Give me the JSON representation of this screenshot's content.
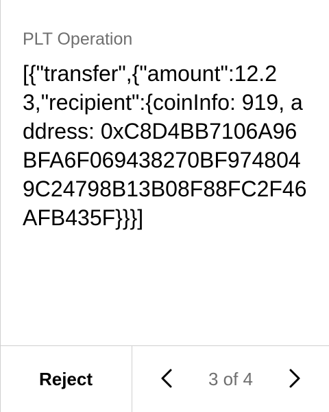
{
  "operation": {
    "label": "PLT Operation",
    "value": "[{\"transfer\",{\"amount\":12.23,\"recipient\":{coinInfo: 919, address: 0xC8D4BB7106A96BFA6F069438270BF9748049C24798B13B08F88FC2F46AFB435F}}}]"
  },
  "footer": {
    "reject_label": "Reject",
    "pagination": {
      "text": "3 of 4",
      "current": 3,
      "total": 4
    }
  },
  "icons": {
    "prev": "chevron-left-icon",
    "next": "chevron-right-icon"
  },
  "colors": {
    "label_text": "#6f6f6f",
    "value_text": "#000000",
    "divider": "#cfcfcf",
    "background": "#ffffff"
  }
}
